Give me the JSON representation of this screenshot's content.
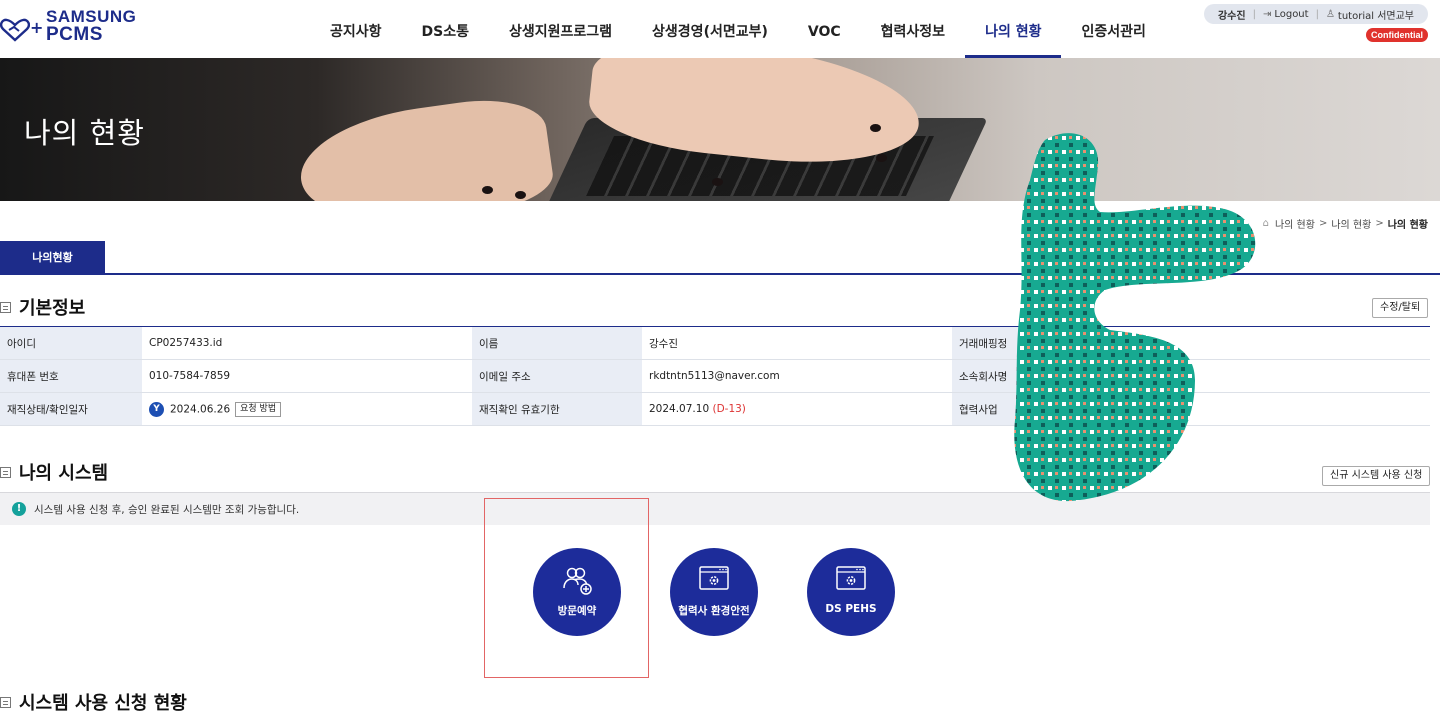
{
  "header": {
    "logo_line1": "SAMSUNG",
    "logo_line2": "PCMS",
    "logo_plus": "+",
    "nav": [
      {
        "label": "공지사항"
      },
      {
        "label": "DS소통"
      },
      {
        "label": "상생지원프로그램"
      },
      {
        "label": "상생경영(서면교부)"
      },
      {
        "label": "VOC"
      },
      {
        "label": "협력사정보"
      },
      {
        "label": "나의 현황",
        "active": true
      },
      {
        "label": "인증서관리"
      }
    ],
    "user_name": "강수진",
    "logout_label": "Logout",
    "user_account": "tutorial 서면교부",
    "confidential": "Confidential"
  },
  "banner": {
    "title": "나의 현황"
  },
  "breadcrumb": [
    "나의 현황",
    "나의 현황",
    "나의 현황"
  ],
  "tab": {
    "label": "나의현황"
  },
  "basic_info": {
    "title": "기본정보",
    "edit_button": "수정/탈퇴",
    "rows": [
      [
        {
          "label": "아이디",
          "value": "CP0257433.id"
        },
        {
          "label": "이름",
          "value": "강수진"
        },
        {
          "label": "거래매핑정",
          "value": ""
        }
      ],
      [
        {
          "label": "휴대폰 번호",
          "value": "010-7584-7859"
        },
        {
          "label": "이메일 주소",
          "value": "rkdtntn5113@naver.com"
        },
        {
          "label": "소속회사명",
          "value": ""
        }
      ],
      [
        {
          "label": "재직상태/확인일자",
          "value": "2024.06.26",
          "badge": "Y",
          "button": "요청 방법"
        },
        {
          "label": "재직확인 유효기한",
          "value": "2024.07.10",
          "dday": "(D-13)"
        },
        {
          "label": "협력사업",
          "value": ""
        }
      ]
    ]
  },
  "my_system": {
    "title": "나의 시스템",
    "new_request_button": "신규 시스템 사용 신청",
    "notice": "시스템 사용 신청 후, 승인 완료된 시스템만 조회 가능합니다.",
    "notice_icon": "!",
    "systems": [
      {
        "name": "방문예약",
        "icon": "visitors-icon"
      },
      {
        "name": "협력사 환경안전",
        "icon": "window-gear-icon"
      },
      {
        "name": "DS PEHS",
        "icon": "window-gear-icon"
      }
    ]
  },
  "request_status": {
    "title": "시스템 사용 신청 현황"
  },
  "colors": {
    "brand": "#1d2c8a",
    "circle": "#1d2c9a",
    "confidential": "#e0322d",
    "notice_icon": "#14a19b",
    "overlay": "#17a991"
  }
}
